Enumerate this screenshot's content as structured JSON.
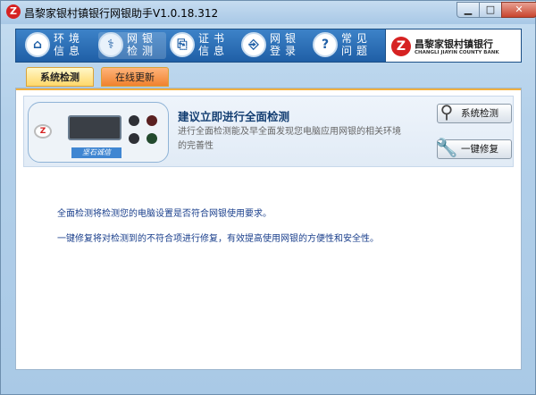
{
  "window": {
    "title": "昌黎家银村镇银行网银助手V1.0.18.312",
    "app_icon": "Z",
    "min_label": "▁",
    "max_label": "□",
    "close_label": "✕"
  },
  "nav": {
    "items": [
      {
        "label": "环境信息",
        "icon": "⌂"
      },
      {
        "label": "网银检测",
        "icon": "⚕"
      },
      {
        "label": "证书信息",
        "icon": "⎘"
      },
      {
        "label": "网银登录",
        "icon": "⎆"
      },
      {
        "label": "常见问题",
        "icon": "?"
      }
    ]
  },
  "logo": {
    "mark": "Z",
    "name_cn": "昌黎家银村镇银行",
    "name_en": "CHANGLI JIAYIN COUNTY BANK"
  },
  "tabs": [
    "系统检测",
    "在线更新"
  ],
  "banner": {
    "headline": "建议立即进行全面检测",
    "description": "进行全面检测能及早全面发现您电脑应用网银的相关环境的完善性",
    "device_brand": "坚石诚信",
    "device_clip": "Z"
  },
  "buttons": {
    "check": {
      "label": "系统检测",
      "icon": "magnifier-icon"
    },
    "repair": {
      "label": "一键修复",
      "icon": "wrench-icon"
    }
  },
  "info": {
    "line1": "全面检测将检测您的电脑设置是否符合网银使用要求。",
    "line2": "一键修复将对检测到的不符合项进行修复，有效提高使用网银的方便性和安全性。"
  },
  "colors": {
    "nav_bg": "#2b6db3",
    "accent_red": "#d62222",
    "tab_active": "#ffd86a",
    "tab_inactive": "#f0822e",
    "info_text": "#1a3f8c"
  }
}
